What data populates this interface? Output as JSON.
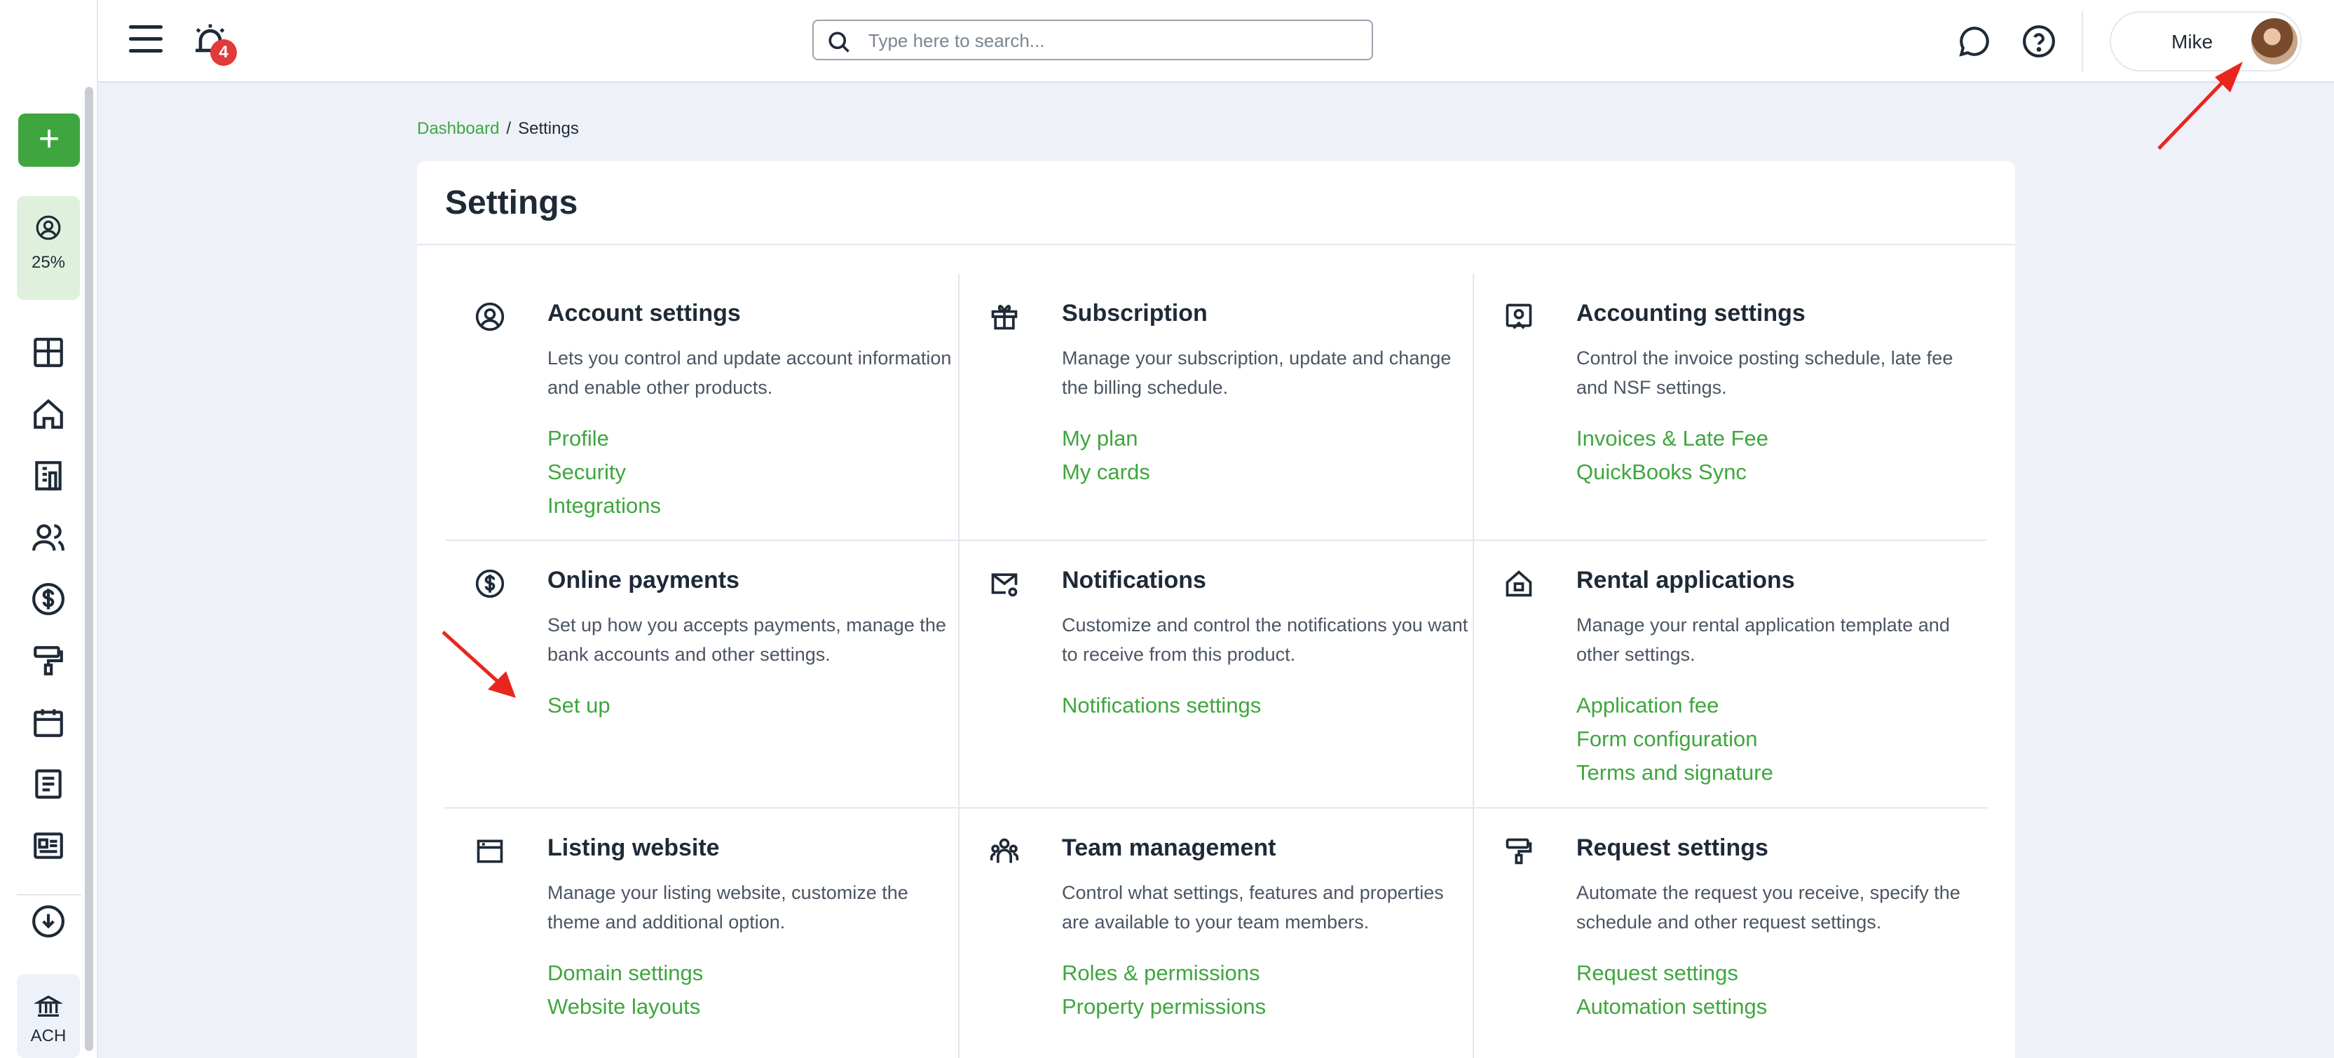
{
  "topbar": {
    "notification_count": "4",
    "search_placeholder": "Type here to search...",
    "user_name": "Mike"
  },
  "sidebar": {
    "progress_label": "25%",
    "ach_label": "ACH",
    "icons": [
      "plus-icon",
      "user-circle-icon",
      "dashboard-icon",
      "home-icon",
      "building-icon",
      "people-icon",
      "dollar-icon",
      "paint-roller-icon",
      "calendar-icon",
      "document-icon",
      "id-card-icon",
      "cloud-download-icon",
      "bank-icon"
    ]
  },
  "breadcrumb": {
    "root": "Dashboard",
    "separator": "/",
    "current": "Settings"
  },
  "page": {
    "title": "Settings"
  },
  "sections": [
    {
      "title": "Account settings",
      "description": "Lets you control and update account information and enable other products.",
      "links": [
        "Profile",
        "Security",
        "Integrations"
      ]
    },
    {
      "title": "Subscription",
      "description": "Manage your subscription, update and change the billing schedule.",
      "links": [
        "My plan",
        "My cards"
      ]
    },
    {
      "title": "Accounting settings",
      "description": "Control the invoice posting schedule, late fee and NSF settings.",
      "links": [
        "Invoices & Late Fee",
        "QuickBooks Sync"
      ]
    },
    {
      "title": "Online payments",
      "description": "Set up how you accepts payments, manage the bank accounts and other settings.",
      "links": [
        "Set up"
      ]
    },
    {
      "title": "Notifications",
      "description": "Customize and control the notifications you want to receive from this product.",
      "links": [
        "Notifications settings"
      ]
    },
    {
      "title": "Rental applications",
      "description": "Manage your rental application template and other settings.",
      "links": [
        "Application fee",
        "Form configuration",
        "Terms and signature"
      ]
    },
    {
      "title": "Listing website",
      "description": "Manage your listing website, customize the theme and additional option.",
      "links": [
        "Domain settings",
        "Website layouts"
      ]
    },
    {
      "title": "Team management",
      "description": "Control what settings, features and properties are available to your team members.",
      "links": [
        "Roles & permissions",
        "Property permissions"
      ]
    },
    {
      "title": "Request settings",
      "description": "Automate the request you receive, specify the schedule and other request settings.",
      "links": [
        "Request settings",
        "Automation settings"
      ]
    }
  ],
  "colors": {
    "accent_green": "#3fa63f",
    "badge_red": "#e03a3a",
    "annotation_arrow": "#e8261f",
    "background": "#eef2f8"
  }
}
